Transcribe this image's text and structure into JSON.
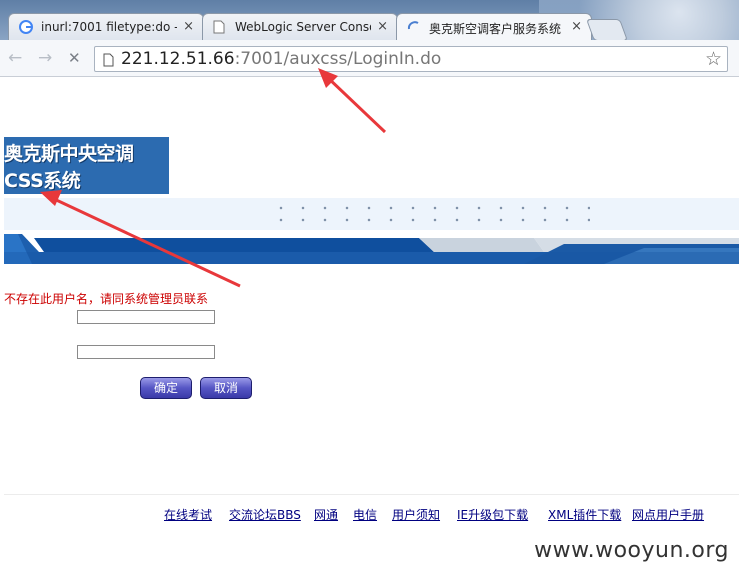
{
  "browser": {
    "tabs": [
      {
        "title": "inurl:7001 filetype:do - G",
        "icon": "google-icon"
      },
      {
        "title": "WebLogic Server Conso",
        "icon": "page-icon"
      },
      {
        "title": "奥克斯空调客户服务系统",
        "icon": "loading-icon",
        "active": true
      }
    ],
    "close_glyph": "×",
    "nav": {
      "back": "←",
      "forward": "→",
      "stop": "✕"
    },
    "url": {
      "host": "221.12.51.66",
      "rest": ":7001/auxcss/LoginIn.do"
    },
    "star_glyph": "☆"
  },
  "page": {
    "logo_text": "奥克斯中央空调CSS系统",
    "error_message": "不存在此用户名，请同系统管理员联系",
    "username_value": "",
    "password_value": "",
    "confirm_label": "确定",
    "cancel_label": "取消",
    "footer_links": [
      "在线考试",
      "交流论坛BBS",
      "网通",
      "电信",
      "用户须知",
      "IE升级包下载",
      "XML插件下载",
      "网点用户手册"
    ]
  },
  "watermark": "www.wooyun.org",
  "colors": {
    "arrow": "#e8383b",
    "error": "#cc0000",
    "logo_bg": "#2c6bb0",
    "link": "#000080"
  }
}
